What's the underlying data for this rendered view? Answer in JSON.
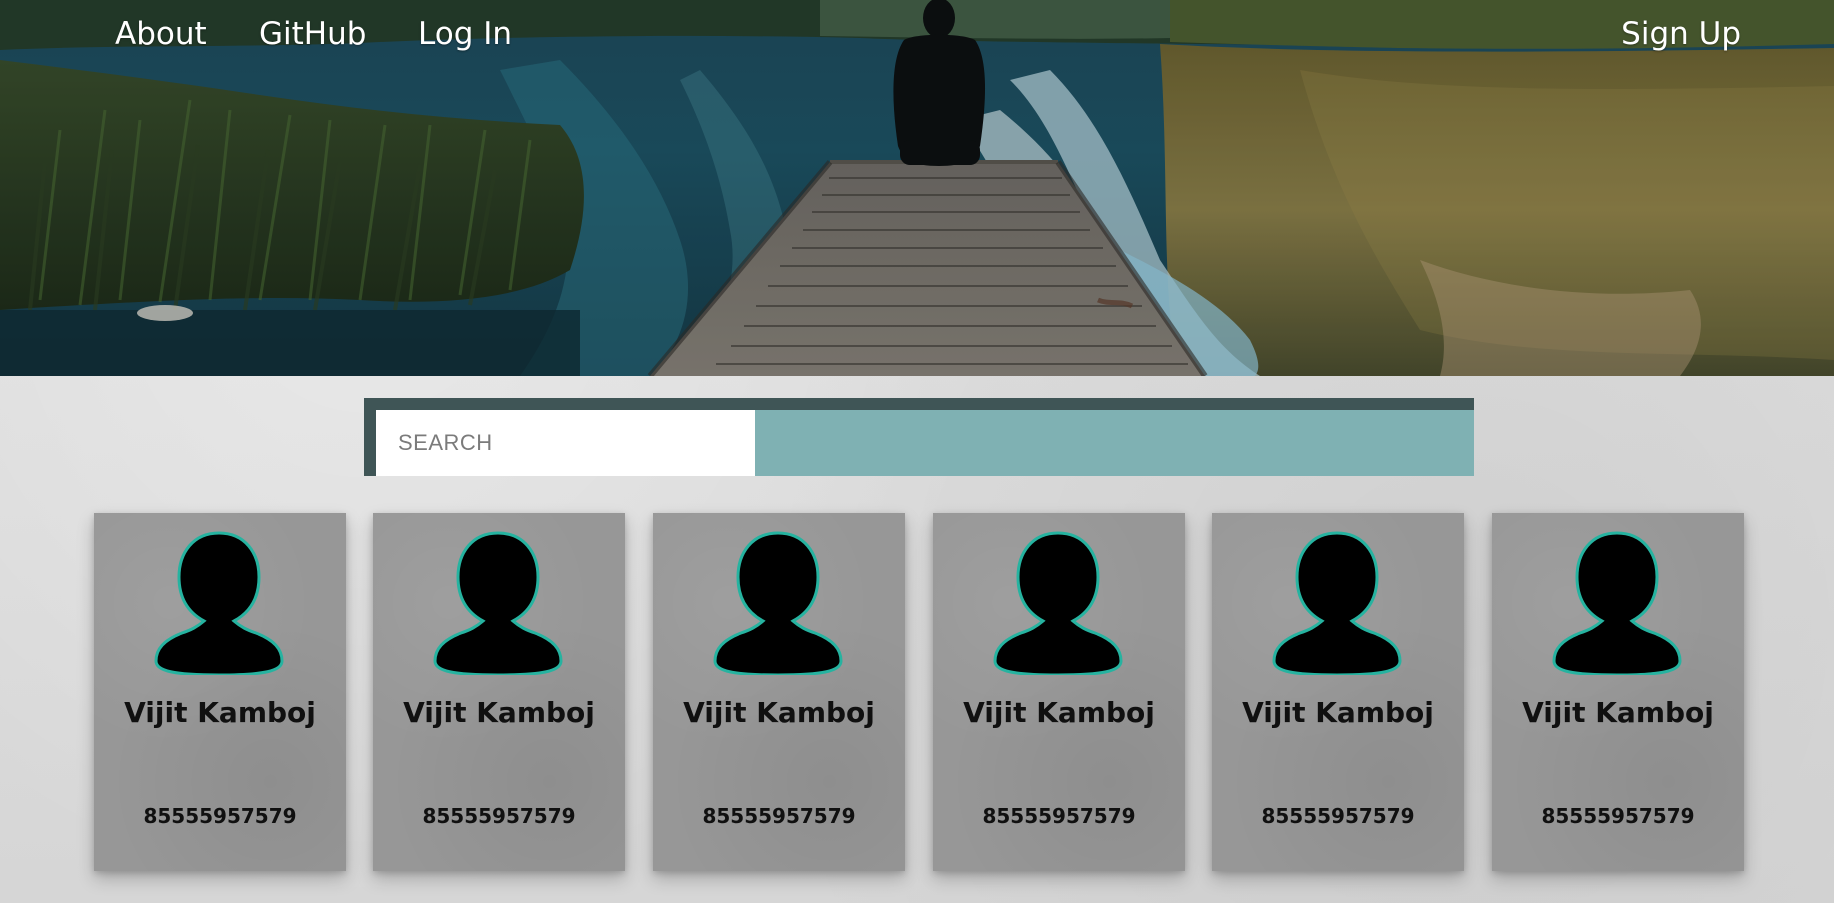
{
  "nav": {
    "about": "About",
    "github": "GitHub",
    "login": "Log In",
    "signup": "Sign Up"
  },
  "search": {
    "placeholder": "SEARCH",
    "accent_color": "#7fb1b3",
    "border_color": "#3f5556"
  },
  "cards": [
    {
      "name": "Vijit Kamboj",
      "phone": "85555957579"
    },
    {
      "name": "Vijit Kamboj",
      "phone": "85555957579"
    },
    {
      "name": "Vijit Kamboj",
      "phone": "85555957579"
    },
    {
      "name": "Vijit Kamboj",
      "phone": "85555957579"
    },
    {
      "name": "Vijit Kamboj",
      "phone": "85555957579"
    },
    {
      "name": "Vijit Kamboj",
      "phone": "85555957579"
    }
  ],
  "icons": {
    "avatar": "user-avatar-icon"
  },
  "colors": {
    "card_bg": "#979797",
    "avatar_fill": "#000000",
    "avatar_outline": "#26b3a0"
  }
}
